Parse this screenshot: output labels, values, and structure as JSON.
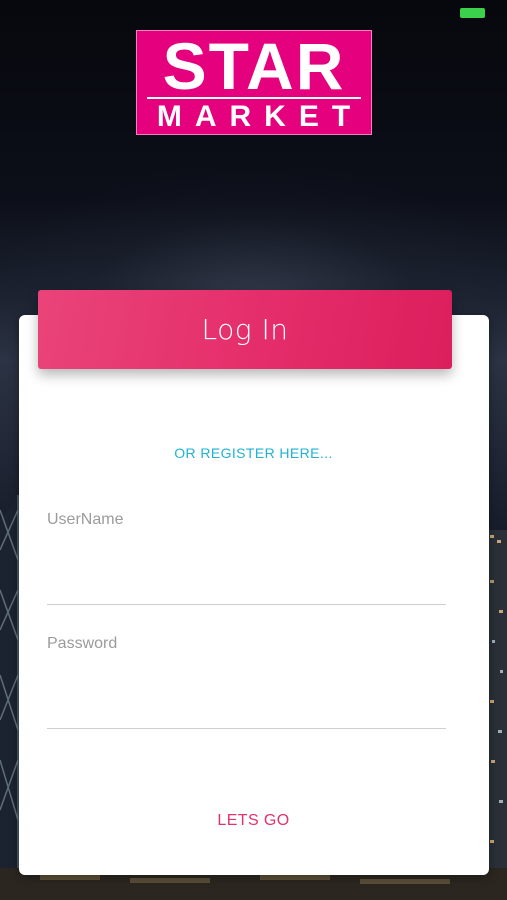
{
  "status_bar": {
    "battery_icon": "battery-icon",
    "battery_color": "#3ad14d"
  },
  "logo": {
    "line1": "STAR",
    "line2": "MARKET",
    "color": "#e5007e"
  },
  "login": {
    "title": "Log In",
    "register_link": "OR REGISTER HERE...",
    "username_label": "UserName",
    "username_value": "",
    "password_label": "Password",
    "password_value": "",
    "submit_label": "LETS GO"
  },
  "colors": {
    "accent": "#e52f6c",
    "link": "#1fb3d4",
    "label": "#9b9b9b"
  }
}
